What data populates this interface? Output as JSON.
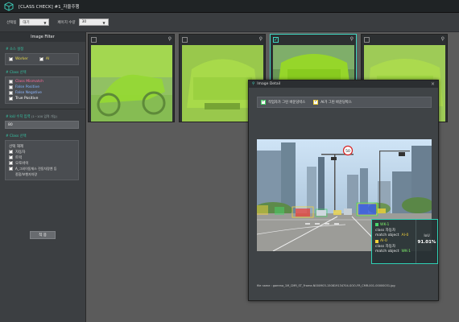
{
  "app": {
    "title": "[CLASS CHECK] #1_자율주행"
  },
  "toolbar": {
    "filter1_label": "선택됨",
    "filter1_value": "대기",
    "filter2_label": "페이지 수량",
    "filter2_value": "30"
  },
  "sidebar": {
    "header": "Image Filter",
    "source_title": "# 소스 설정",
    "worker_label": "Worker",
    "ai_label": "AI",
    "class_title": "# Class 선택",
    "class_items": [
      {
        "label": "Class Mismatch",
        "color": "#ff6a9a",
        "checked": false
      },
      {
        "label": "False Positive",
        "color": "#7fb4ff",
        "checked": false
      },
      {
        "label": "False Negative",
        "color": "#8fb8ff",
        "checked": false
      },
      {
        "label": "True Positive",
        "color": "#ffffff",
        "checked": true
      }
    ],
    "iou_title": "# IoU 수치 입력",
    "iou_hint": "(1~100 입력 가능)",
    "iou_value": "80",
    "class_select_title": "# Class 선택",
    "select_all": "선택 해제",
    "class_list": [
      {
        "label": "자동차",
        "checked": true
      },
      {
        "label": "트럭",
        "checked": true
      },
      {
        "label": "오토바이",
        "checked": true
      },
      {
        "label": "A_그외이동체스 전동차량엔 등",
        "checked": true
      },
      {
        "label": "종합/보행자차량",
        "checked": false
      }
    ],
    "apply_label": "적 용"
  },
  "gallery": {
    "cards": [
      {
        "selected": false
      },
      {
        "selected": false
      },
      {
        "selected": true
      },
      {
        "selected": false
      }
    ]
  },
  "modal": {
    "title": "Image Detail",
    "opt_worker": "작업자가 그린 바운딩박스",
    "opt_ai": "AI가 그린 바운딩박스",
    "file_name": "file name : gamma_1M_CMR_ST_Frame-N000903-150819134704-SOO-FR_CMR-001-00000031.jpg",
    "sign_text": "50"
  },
  "info": {
    "wk_title": "WK-1",
    "wk_class": "class  자동차",
    "wk_match_label": "match object",
    "wk_match": "AI-0",
    "ai_title": "AI-0",
    "ai_class": "class  자동차",
    "ai_match_label": "match object",
    "ai_match": "WK-1",
    "iou_label": "IoU",
    "iou_value": "91.01%"
  },
  "colors": {
    "teal": "#3fd6c1",
    "worker_box": "#49d46a",
    "ai_box": "#f2d23b",
    "overlay_green": "#8ce21a"
  }
}
